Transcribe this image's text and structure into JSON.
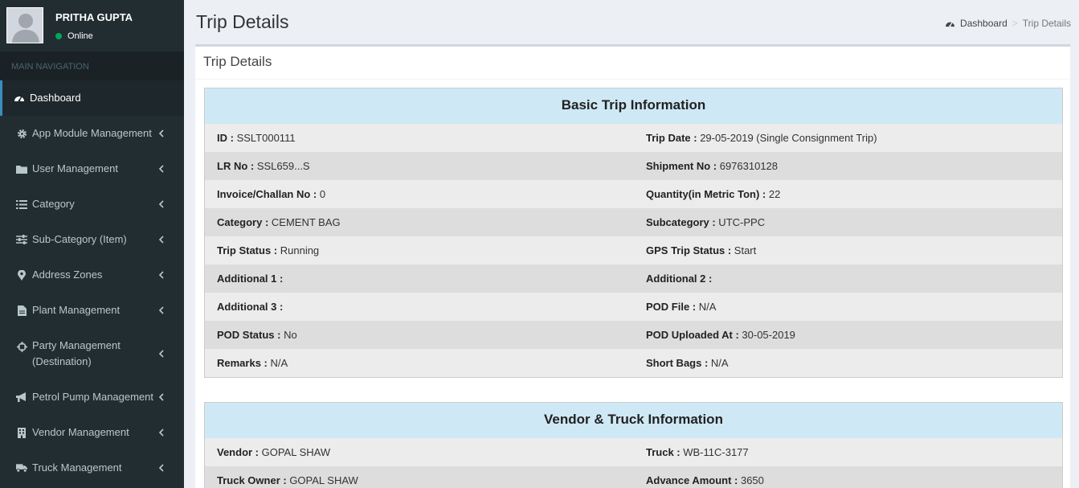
{
  "user": {
    "name": "PRITHA GUPTA",
    "status": "Online"
  },
  "nav": {
    "header": "MAIN NAVIGATION",
    "items": [
      {
        "label": "Dashboard",
        "icon": "dashboard-icon"
      },
      {
        "label": "App Module Management",
        "icon": "gear-icon"
      },
      {
        "label": "User Management",
        "icon": "folder-icon"
      },
      {
        "label": "Category",
        "icon": "list-icon"
      },
      {
        "label": "Sub-Category (Item)",
        "icon": "sliders-icon"
      },
      {
        "label": "Address Zones",
        "icon": "map-marker-icon"
      },
      {
        "label": "Plant Management",
        "icon": "file-icon"
      },
      {
        "label": "Party Management",
        "label2": "(Destination)",
        "icon": "crosshairs-icon"
      },
      {
        "label": "Petrol Pump Management",
        "icon": "bullhorn-icon"
      },
      {
        "label": "Vendor Management",
        "icon": "building-icon"
      },
      {
        "label": "Truck Management",
        "icon": "truck-icon"
      }
    ]
  },
  "header": {
    "title": "Trip Details"
  },
  "breadcrumb": {
    "home": "Dashboard",
    "separator": ">",
    "current": "Trip Details"
  },
  "box": {
    "title": "Trip Details"
  },
  "basic": {
    "title": "Basic Trip Information",
    "rows": [
      {
        "l_label": "ID :",
        "l_value": " SSLT000111",
        "r_label": "Trip Date :",
        "r_value": " 29-05-2019 (Single Consignment Trip)"
      },
      {
        "l_label": "LR No :",
        "l_value": " SSL659...S",
        "r_label": "Shipment No :",
        "r_value": " 6976310128"
      },
      {
        "l_label": "Invoice/Challan No :",
        "l_value": " 0",
        "r_label": "Quantity(in Metric Ton) :",
        "r_value": " 22"
      },
      {
        "l_label": "Category :",
        "l_value": " CEMENT BAG",
        "r_label": "Subcategory :",
        "r_value": " UTC-PPC"
      },
      {
        "l_label": "Trip Status :",
        "l_value": " Running",
        "r_label": "GPS Trip Status :",
        "r_value": " Start"
      },
      {
        "l_label": "Additional 1 :",
        "l_value": "",
        "r_label": "Additional 2 :",
        "r_value": ""
      },
      {
        "l_label": "Additional 3 :",
        "l_value": "",
        "r_label": "POD File :",
        "r_value": " N/A"
      },
      {
        "l_label": "POD Status :",
        "l_value": " No",
        "r_label": "POD Uploaded At :",
        "r_value": " 30-05-2019"
      },
      {
        "l_label": "Remarks :",
        "l_value": " N/A",
        "r_label": "Short Bags :",
        "r_value": " N/A"
      }
    ]
  },
  "vendor": {
    "title": "Vendor & Truck Information",
    "rows": [
      {
        "l_label": "Vendor :",
        "l_value": " GOPAL SHAW",
        "r_label": "Truck :",
        "r_value": " WB-11C-3177"
      },
      {
        "l_label": "Truck Owner :",
        "l_value": " GOPAL SHAW",
        "r_label": "Advance Amount :",
        "r_value": " 3650"
      }
    ]
  },
  "colors": {
    "sidebar": "#222d32",
    "accent": "#3c8dbc",
    "panel_header": "#cfe8f5",
    "online": "#00a65a"
  }
}
